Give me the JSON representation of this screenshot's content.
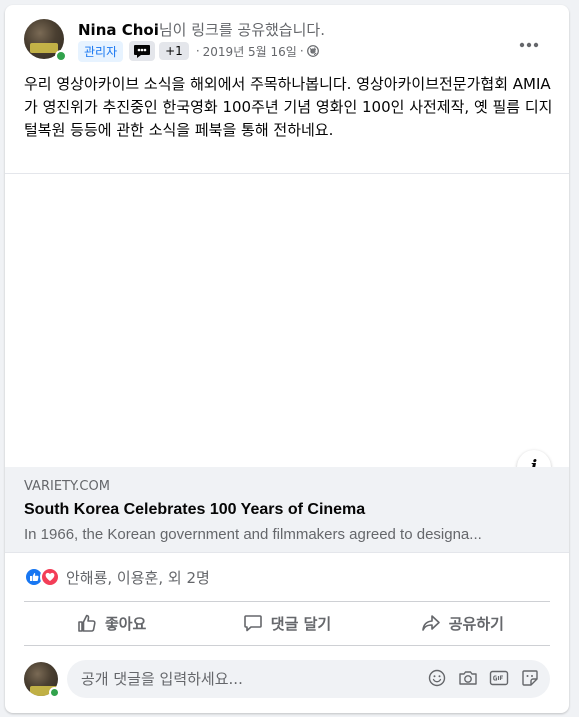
{
  "post": {
    "author": "Nina Choi",
    "action_text": "님이 링크를 공유했습니다.",
    "badge_admin": "관리자",
    "badge_plus": "+1",
    "date": "2019년 5월 16일",
    "separator": "·",
    "privacy_icon": "globe-icon",
    "text": "우리 영상아카이브 소식을 해외에서 주목하나봅니다. 영상아카이브전문가협회 AMIA가 영진위가 추진중인 한국영화 100주년 기념 영화인 100인 사전제작, 옛 필름 디지털복원 등등에 관한 소식을 페북을 통해 전하네요."
  },
  "link": {
    "domain": "VARIETY.COM",
    "title": "South Korea Celebrates 100 Years of Cinema",
    "description": "In 1966, the Korean government and filmmakers agreed to designa..."
  },
  "reactions": {
    "types": [
      "like",
      "love"
    ],
    "names": "안해룡, 이용훈, 외 2명"
  },
  "actions": {
    "like": "좋아요",
    "comment": "댓글 달기",
    "share": "공유하기"
  },
  "comment": {
    "placeholder": "공개 댓글을 입력하세요..."
  },
  "colors": {
    "accent": "#1877f2",
    "love": "#f33e58",
    "online": "#31a24c",
    "secondary_text": "#65676b"
  }
}
